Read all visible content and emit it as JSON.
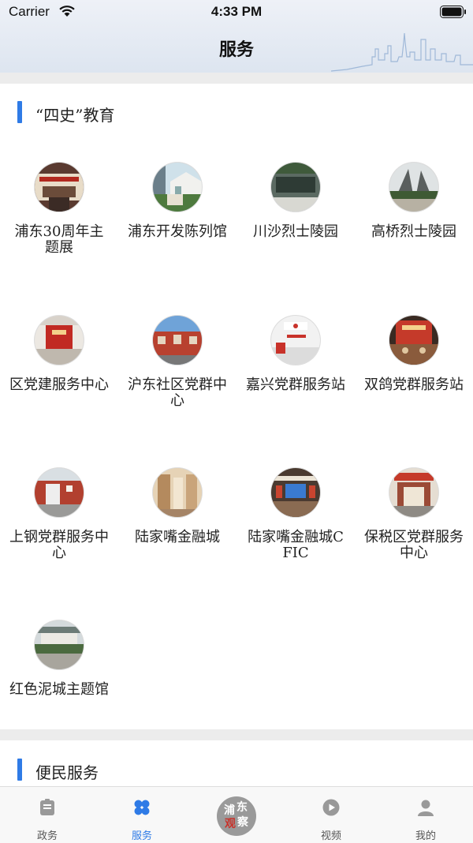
{
  "status": {
    "carrier": "Carrier",
    "time": "4:33 PM"
  },
  "nav": {
    "title": "服务"
  },
  "sections": [
    {
      "title": "“四史”教育",
      "items": [
        {
          "label": "浦东30周年主题展"
        },
        {
          "label": "浦东开发陈列馆"
        },
        {
          "label": "川沙烈士陵园"
        },
        {
          "label": "高桥烈士陵园"
        },
        {
          "label": "区党建服务中心"
        },
        {
          "label": "沪东社区党群中心"
        },
        {
          "label": "嘉兴党群服务站"
        },
        {
          "label": "双鸽党群服务站"
        },
        {
          "label": "上钢党群服务中心"
        },
        {
          "label": "陆家嘴金融城"
        },
        {
          "label": "陆家嘴金融城CFIC"
        },
        {
          "label": "保税区党群服务中心"
        },
        {
          "label": "红色泥城主题馆"
        }
      ]
    },
    {
      "title": "便民服务"
    }
  ],
  "tabbar": {
    "tabs": [
      {
        "label": "政务",
        "icon": "clipboard-icon"
      },
      {
        "label": "服务",
        "icon": "clover-icon",
        "active": true
      },
      {
        "label": "",
        "icon": "pudong-logo",
        "logo_text": [
          "浦",
          "东",
          "观",
          "察"
        ]
      },
      {
        "label": "视频",
        "icon": "play-icon"
      },
      {
        "label": "我的",
        "icon": "user-icon"
      }
    ]
  },
  "colors": {
    "accent": "#2f7be6",
    "inactive": "#999999"
  }
}
